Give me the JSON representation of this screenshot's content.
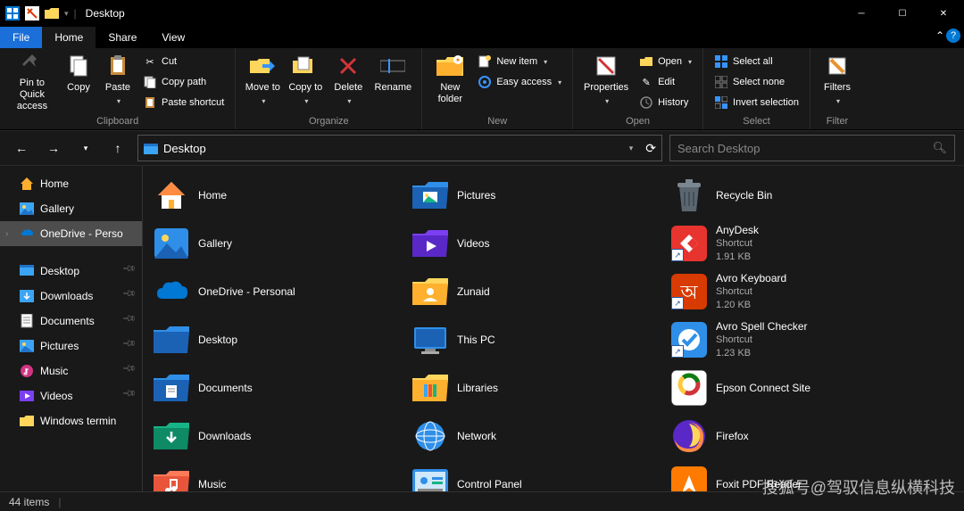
{
  "window": {
    "title": "Desktop",
    "minimize": "─",
    "maximize": "☐",
    "close": "✕"
  },
  "menu": {
    "file": "File",
    "home": "Home",
    "share": "Share",
    "view": "View"
  },
  "ribbon": {
    "clipboard": {
      "label": "Clipboard",
      "pin": "Pin to Quick access",
      "copy": "Copy",
      "paste": "Paste",
      "cut": "Cut",
      "copy_path": "Copy path",
      "paste_shortcut": "Paste shortcut"
    },
    "organize": {
      "label": "Organize",
      "move_to": "Move to",
      "copy_to": "Copy to",
      "delete": "Delete",
      "rename": "Rename"
    },
    "new": {
      "label": "New",
      "new_folder": "New folder",
      "new_item": "New item",
      "easy_access": "Easy access"
    },
    "open": {
      "label": "Open",
      "properties": "Properties",
      "open": "Open",
      "edit": "Edit",
      "history": "History"
    },
    "select": {
      "label": "Select",
      "select_all": "Select all",
      "select_none": "Select none",
      "invert": "Invert selection"
    },
    "filter": {
      "label": "Filter",
      "filters": "Filters"
    }
  },
  "nav": {
    "location": "Desktop"
  },
  "search": {
    "placeholder": "Search Desktop"
  },
  "sidebar": {
    "home": "Home",
    "gallery": "Gallery",
    "onedrive": "OneDrive - Perso",
    "desktop": "Desktop",
    "downloads": "Downloads",
    "documents": "Documents",
    "pictures": "Pictures",
    "music": "Music",
    "videos": "Videos",
    "windows_terminal": "Windows termin"
  },
  "items": [
    {
      "name": "Home"
    },
    {
      "name": "Gallery"
    },
    {
      "name": "OneDrive - Personal"
    },
    {
      "name": "Desktop"
    },
    {
      "name": "Documents"
    },
    {
      "name": "Downloads"
    },
    {
      "name": "Music"
    },
    {
      "name": "Pictures"
    },
    {
      "name": "Videos"
    },
    {
      "name": "Zunaid"
    },
    {
      "name": "This PC"
    },
    {
      "name": "Libraries"
    },
    {
      "name": "Network"
    },
    {
      "name": "Control Panel"
    },
    {
      "name": "Recycle Bin"
    },
    {
      "name": "AnyDesk",
      "sub1": "Shortcut",
      "sub2": "1.91 KB"
    },
    {
      "name": "Avro Keyboard",
      "sub1": "Shortcut",
      "sub2": "1.20 KB"
    },
    {
      "name": "Avro Spell Checker",
      "sub1": "Shortcut",
      "sub2": "1.23 KB"
    },
    {
      "name": "Epson Connect Site"
    },
    {
      "name": "Firefox"
    },
    {
      "name": "Foxit PDF Reader"
    }
  ],
  "status": {
    "count": "44 items"
  },
  "watermark": "搜狐号@驾驭信息纵横科技"
}
